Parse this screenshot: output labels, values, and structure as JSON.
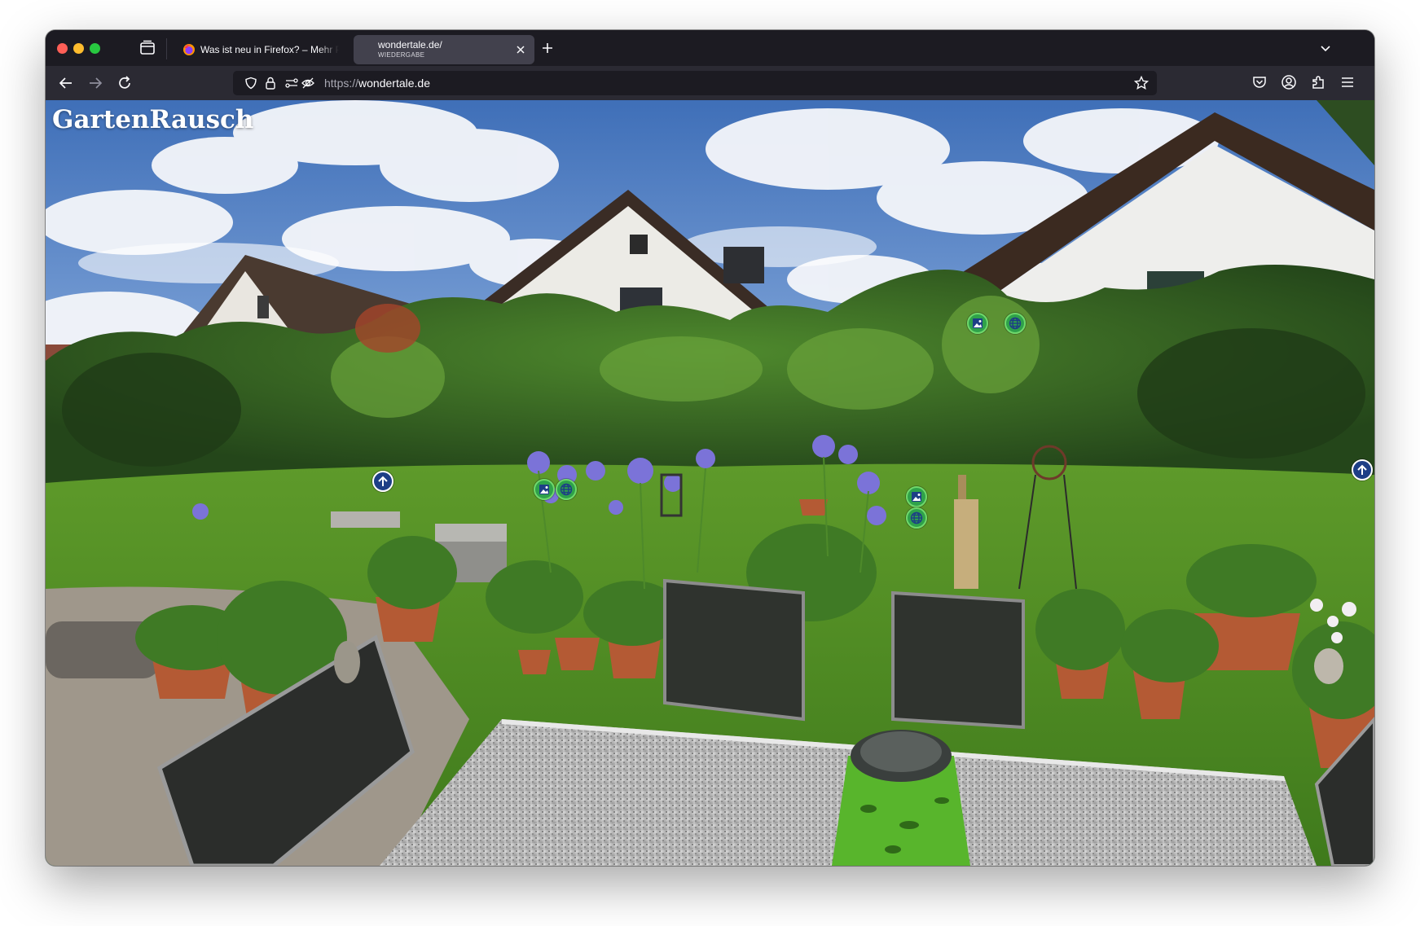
{
  "browser": {
    "tabs": [
      {
        "title": "Was ist neu in Firefox? – Mehr Privatsphäre",
        "subtitle": "",
        "active": false
      },
      {
        "title": "wondertale.de/",
        "subtitle": "WIEDERGABE",
        "active": true
      }
    ],
    "url": {
      "protocol": "https://",
      "host": "wondertale.de"
    }
  },
  "page": {
    "site_title": "GartenRausch"
  },
  "hotspots": [
    {
      "kind": "image-hotspot",
      "icon": "photo-icon"
    },
    {
      "kind": "web-hotspot",
      "icon": "globe-icon"
    },
    {
      "kind": "image-hotspot",
      "icon": "photo-icon"
    },
    {
      "kind": "web-hotspot",
      "icon": "globe-icon"
    },
    {
      "kind": "image-hotspot",
      "icon": "photo-icon"
    },
    {
      "kind": "web-hotspot",
      "icon": "globe-icon"
    },
    {
      "kind": "navigate-hotspot",
      "icon": "arrow-up-icon"
    },
    {
      "kind": "navigate-hotspot",
      "icon": "arrow-up-icon"
    }
  ],
  "colors": {
    "hotspot_green": "#2fa24a",
    "hotspot_blue": "#1d3e86",
    "toolbar": "#2b2a33",
    "tabstrip": "#1c1b22"
  }
}
